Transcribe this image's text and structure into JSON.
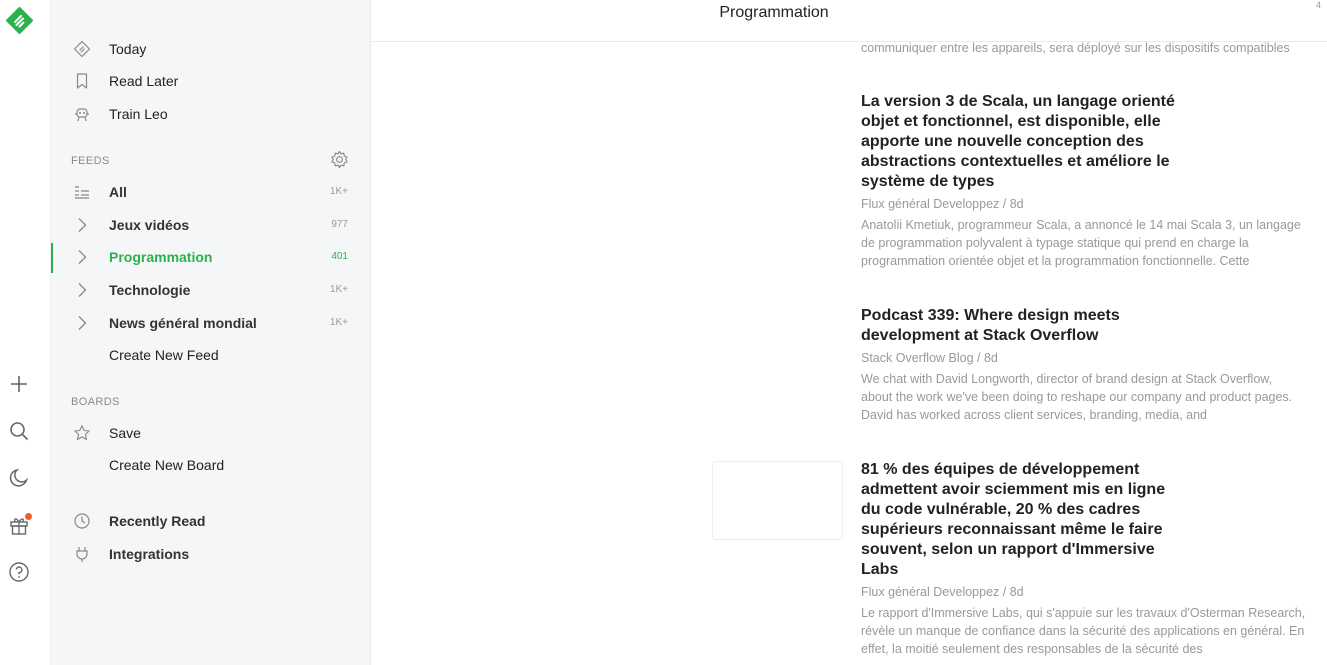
{
  "rail": {
    "icons": [
      "feedly-logo-icon",
      "plus-icon",
      "search-icon",
      "moon-icon",
      "gift-icon",
      "help-icon"
    ],
    "accent": "#2bb24c",
    "notification_color": "#f05b2a"
  },
  "sidebar": {
    "nav": [
      {
        "label": "Today",
        "icon": "today-icon"
      },
      {
        "label": "Read Later",
        "icon": "bookmark-icon"
      },
      {
        "label": "Train Leo",
        "icon": "leo-icon"
      }
    ],
    "feeds_title": "FEEDS",
    "feeds": [
      {
        "label": "All",
        "count": "1K+",
        "icon": "list-icon"
      },
      {
        "label": "Jeux vidéos",
        "count": "977",
        "icon": "chevron-right-icon"
      },
      {
        "label": "Programmation",
        "count": "401",
        "icon": "chevron-right-icon",
        "active": true
      },
      {
        "label": "Technologie",
        "count": "1K+",
        "icon": "chevron-right-icon"
      },
      {
        "label": "News général mondial",
        "count": "1K+",
        "icon": "chevron-right-icon"
      }
    ],
    "create_feed": "Create New Feed",
    "boards_title": "BOARDS",
    "boards": [
      {
        "label": "Save",
        "icon": "star-icon"
      }
    ],
    "create_board": "Create New Board",
    "bottom": [
      {
        "label": "Recently Read",
        "icon": "clock-icon"
      },
      {
        "label": "Integrations",
        "icon": "plug-icon"
      }
    ]
  },
  "main": {
    "title": "Programmation",
    "corner_mark": "4",
    "fragment": "communiquer entre les appareils, sera déployé sur les dispositifs compatibles",
    "articles": [
      {
        "title": "La version 3 de Scala, un langage orienté objet et fonctionnel, est disponible, elle apporte une nouvelle conception des abstractions contextuelles et améliore le système de types",
        "source": "Flux général Developpez / 8d",
        "summary": "Anatolii Kmetiuk, programmeur Scala, a annoncé le 14 mai Scala 3, un langage de programmation polyvalent à typage statique qui prend en charge la programmation orientée objet et la programmation fonctionnelle. Cette"
      },
      {
        "title": "Podcast 339: Where design meets development at Stack Overflow",
        "source": "Stack Overflow Blog / 8d",
        "summary": "We chat with David Longworth, director of brand design at Stack Overflow, about the work we've been doing to reshape our company and product pages. David has worked across client services, branding, media, and"
      },
      {
        "title": "81 % des équipes de développement admettent avoir sciemment mis en ligne du code vulnérable, 20 % des cadres supérieurs reconnaissant même le faire souvent, selon un rapport d'Immersive Labs",
        "source": "Flux général Developpez / 8d",
        "summary": "Le rapport d'Immersive Labs, qui s'appuie sur les travaux d'Osterman Research, révèle un manque de confiance dans la sécurité des applications en général. En effet, la moitié seulement des responsables de la sécurité des"
      }
    ]
  }
}
